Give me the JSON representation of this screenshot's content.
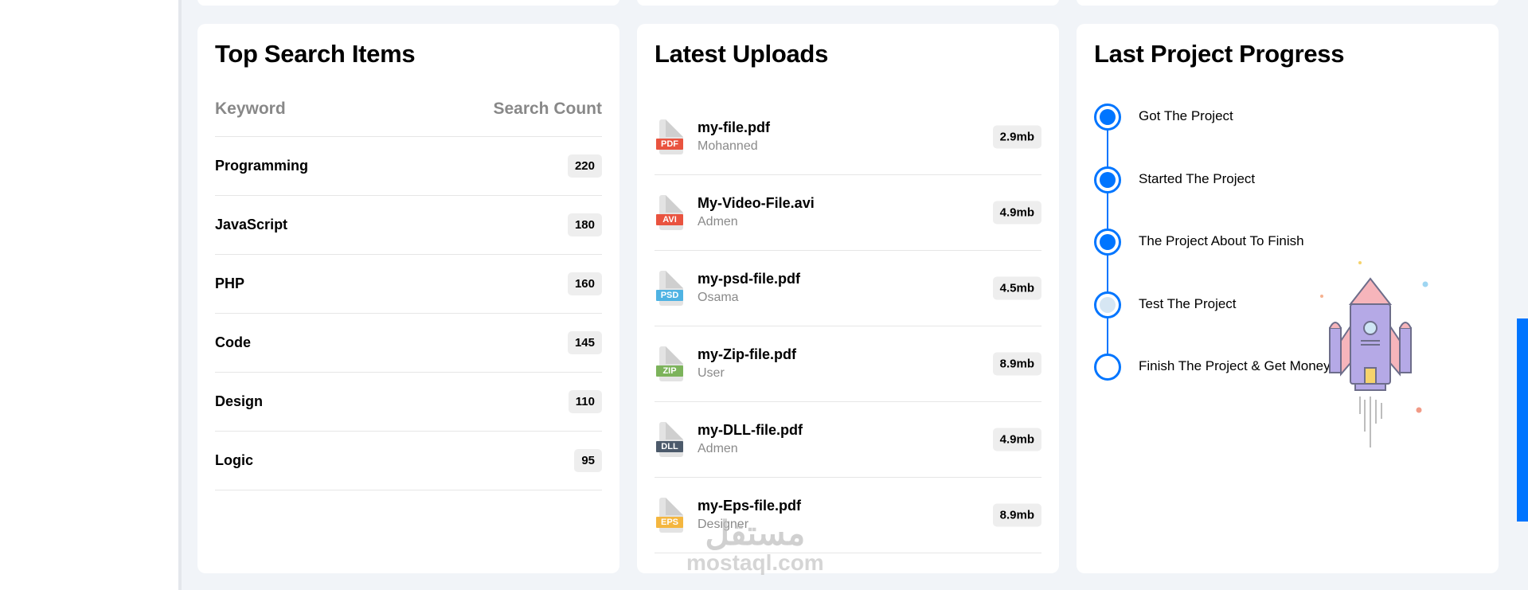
{
  "search": {
    "title": "Top Search Items",
    "col_keyword": "Keyword",
    "col_count": "Search Count",
    "rows": [
      {
        "keyword": "Programming",
        "count": "220"
      },
      {
        "keyword": "JavaScript",
        "count": "180"
      },
      {
        "keyword": "PHP",
        "count": "160"
      },
      {
        "keyword": "Code",
        "count": "145"
      },
      {
        "keyword": "Design",
        "count": "110"
      },
      {
        "keyword": "Logic",
        "count": "95"
      }
    ]
  },
  "uploads": {
    "title": "Latest Uploads",
    "files": [
      {
        "type": "PDF",
        "name": "my-file.pdf",
        "user": "Mohanned",
        "size": "2.9mb",
        "color": "#e9533f"
      },
      {
        "type": "AVI",
        "name": "My-Video-File.avi",
        "user": "Admen",
        "size": "4.9mb",
        "color": "#e9533f"
      },
      {
        "type": "PSD",
        "name": "my-psd-file.pdf",
        "user": "Osama",
        "size": "4.5mb",
        "color": "#4fb3e3"
      },
      {
        "type": "ZIP",
        "name": "my-Zip-file.pdf",
        "user": "User",
        "size": "8.9mb",
        "color": "#7cb35b"
      },
      {
        "type": "DLL",
        "name": "my-DLL-file.pdf",
        "user": "Admen",
        "size": "4.9mb",
        "color": "#4c5a6b"
      },
      {
        "type": "EPS",
        "name": "my-Eps-file.pdf",
        "user": "Designer",
        "size": "8.9mb",
        "color": "#f4b63f"
      }
    ]
  },
  "progress": {
    "title": "Last Project Progress",
    "steps": [
      {
        "label": "Got The Project",
        "state": "done"
      },
      {
        "label": "Started The Project",
        "state": "done"
      },
      {
        "label": "The Project About To Finish",
        "state": "done"
      },
      {
        "label": "Test The Project",
        "state": "current"
      },
      {
        "label": "Finish The Project & Get Money",
        "state": "pending"
      }
    ]
  },
  "watermark": {
    "arabic": "مستقل",
    "latin": "mostaql.com"
  },
  "colors": {
    "accent": "#0075ff",
    "background": "#f1f4f8",
    "card": "#ffffff"
  }
}
